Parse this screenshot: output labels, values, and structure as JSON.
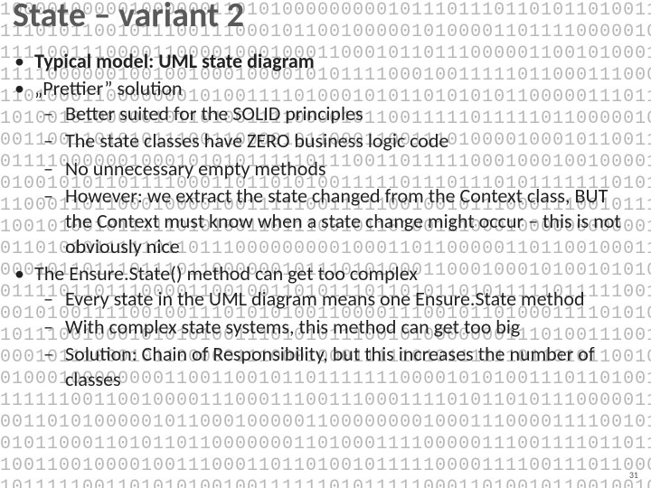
{
  "title": "State – variant 2",
  "bullets": [
    {
      "text": "Typical model: UML state diagram",
      "bold": true
    },
    {
      "text": "„Prettier” solution",
      "children": [
        {
          "text": "Better suited for the SOLID principles"
        },
        {
          "text": "The state classes have ZERO business logic code"
        },
        {
          "text": "No unnecessary empty methods"
        },
        {
          "text": "However: we extract the state changed from the Context class, BUT the Context must know when a state change might occur – this is not obviously nice"
        }
      ]
    },
    {
      "text": "The Ensure.State() method can get too complex",
      "children": [
        {
          "text": "Every state in the UML diagram means one Ensure.State method"
        },
        {
          "text": "With complex state systems, this method can get too big"
        },
        {
          "text": "Solution: Chain of Responsibility, but this increases the number of classes"
        }
      ]
    }
  ],
  "page_number": "31",
  "binary_rows": 23,
  "binary_cols": 64
}
